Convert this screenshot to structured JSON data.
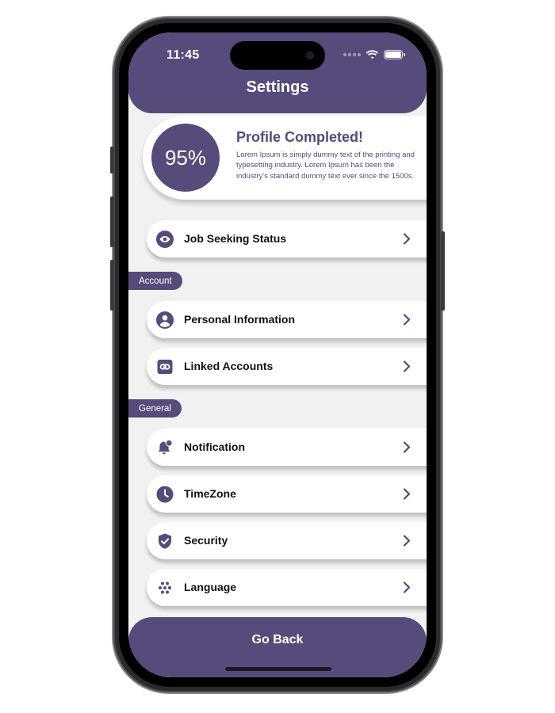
{
  "status_bar": {
    "time": "11:45"
  },
  "header": {
    "title": "Settings"
  },
  "profile": {
    "percent_label": "95%",
    "title": "Profile Completed!",
    "description": "Lorem Ipsum is simply dummy text of the printing and typesetting industry. Lorem Ipsum has been the industry's standard dummy text ever since the 1500s."
  },
  "job_seeking": {
    "label": "Job Seeking Status",
    "icon": "eye-icon"
  },
  "sections": {
    "account": {
      "label": "Account",
      "items": [
        {
          "label": "Personal Information",
          "icon": "person-icon"
        },
        {
          "label": "Linked Accounts",
          "icon": "link-icon"
        }
      ]
    },
    "general": {
      "label": "General",
      "items": [
        {
          "label": "Notification",
          "icon": "bell-icon"
        },
        {
          "label": "TimeZone",
          "icon": "clock-icon"
        },
        {
          "label": "Security",
          "icon": "shield-icon"
        },
        {
          "label": "Language",
          "icon": "language-icon"
        }
      ]
    }
  },
  "footer": {
    "button_label": "Go Back"
  },
  "colors": {
    "brand": "#564b7a",
    "background": "#f1f1f1",
    "card": "#ffffff",
    "text": "#111111"
  }
}
